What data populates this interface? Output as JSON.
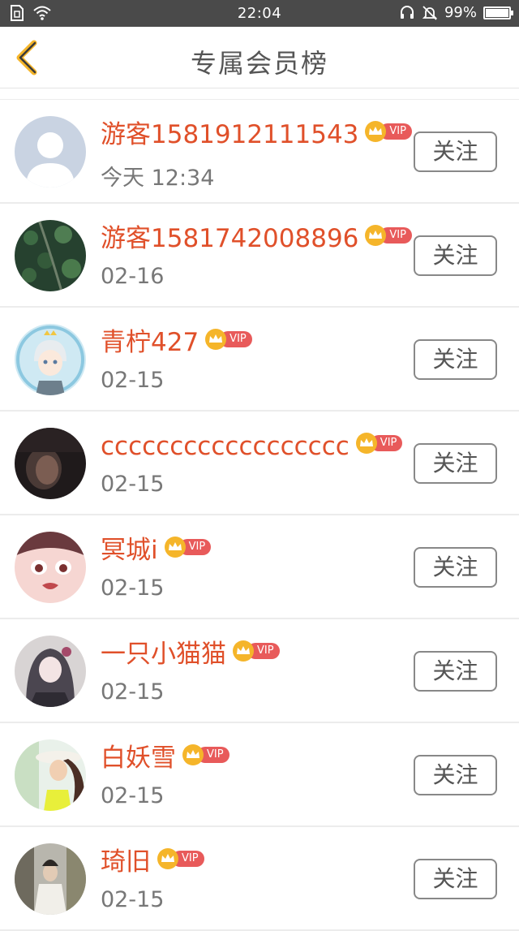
{
  "status_bar": {
    "time": "22:04",
    "battery": "99%",
    "battery_level": 0.99,
    "icons": [
      "sim-icon",
      "wifi-icon",
      "headset-icon",
      "mute-icon",
      "battery-icon"
    ]
  },
  "header": {
    "title": "专属会员榜",
    "back_icon": "chevron-left-icon",
    "accent_color": "#f5b52a"
  },
  "colors": {
    "name": "#e0502a",
    "vip_badge": "#e85a5a",
    "crown": "#f5b52a"
  },
  "members": [
    {
      "name": "游客1581912111543",
      "date": "今天 12:34",
      "vip": "VIP",
      "follow": "关注",
      "avatar": "default-avatar"
    },
    {
      "name": "游客1581742008896",
      "date": "02-16",
      "vip": "VIP",
      "follow": "关注",
      "avatar": "forest-avatar"
    },
    {
      "name": "青柠427",
      "date": "02-15",
      "vip": "VIP",
      "follow": "关注",
      "avatar": "anime-boy-avatar"
    },
    {
      "name": "cccccccccccccccccc",
      "date": "02-15",
      "vip": "VIP",
      "follow": "关注",
      "avatar": "dark-portrait-avatar"
    },
    {
      "name": "冥城i",
      "date": "02-15",
      "vip": "VIP",
      "follow": "关注",
      "avatar": "anime-face-avatar"
    },
    {
      "name": "一只小猫猫",
      "date": "02-15",
      "vip": "VIP",
      "follow": "关注",
      "avatar": "anime-girl-avatar"
    },
    {
      "name": "白妖雪",
      "date": "02-15",
      "vip": "VIP",
      "follow": "关注",
      "avatar": "girl-hat-avatar"
    },
    {
      "name": "琦旧",
      "date": "02-15",
      "vip": "VIP",
      "follow": "关注",
      "avatar": "street-photo-avatar"
    }
  ]
}
